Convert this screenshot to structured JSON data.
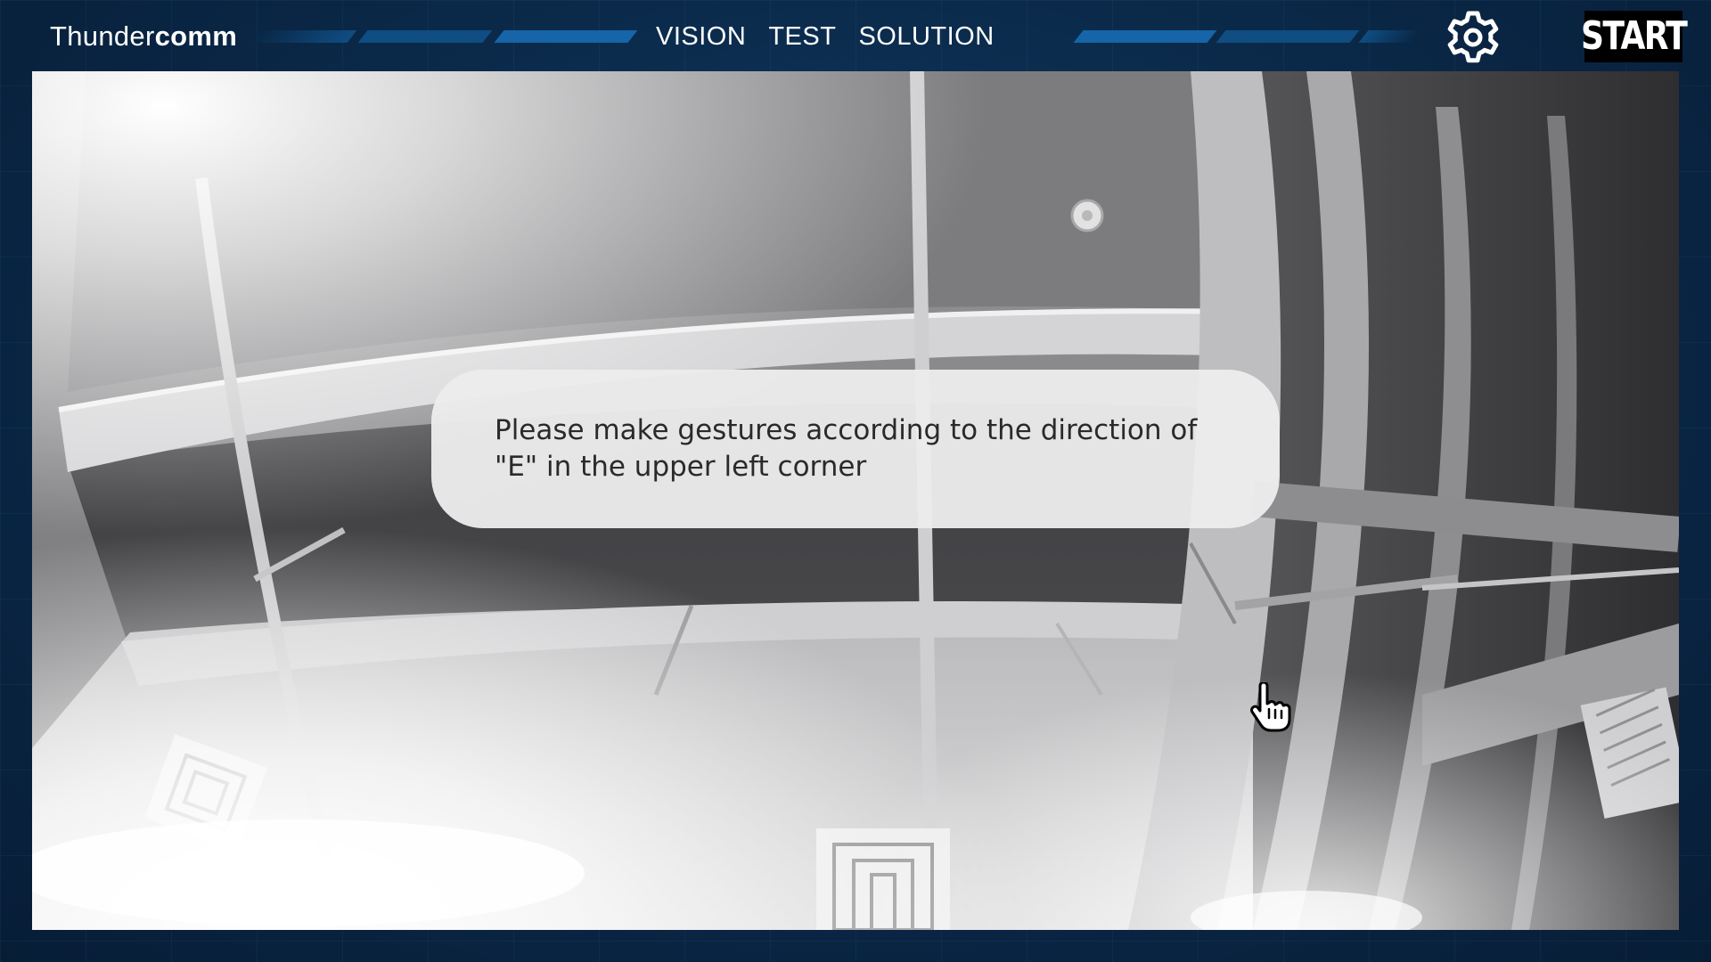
{
  "header": {
    "logo": {
      "light": "Thunder",
      "bold": "comm"
    },
    "nav": [
      "VISION",
      "TEST",
      "SOLUTION"
    ],
    "start_label": "START",
    "settings_icon": "gear-icon"
  },
  "camera_view": {
    "scene_label": "camera-feed"
  },
  "prompt": {
    "text": "Please make gestures according to the direction of\n\"E\" in the upper left corner"
  },
  "cursor_icon": "hand-pointer-icon",
  "colors": {
    "background": "#0a2746",
    "accent": "#1565a8",
    "text": "#ffffff"
  }
}
